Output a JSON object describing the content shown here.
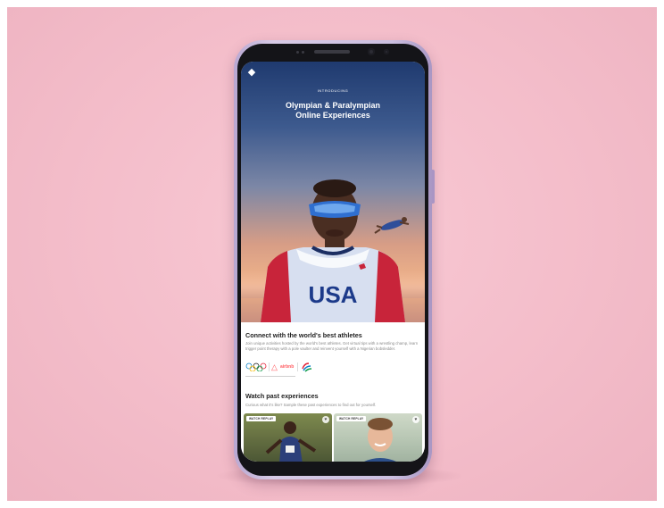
{
  "hero": {
    "eyebrow": "INTRODUCING",
    "title_line1": "Olympian & Paralympian",
    "title_line2": "Online Experiences",
    "jersey_text": "USA"
  },
  "connect": {
    "title": "Connect with the world's best athletes",
    "body": "Join unique activities hosted by the world's best athletes. Get virtual tips with a wrestling champ, learn trigger point therapy with a pole vaulter and reinvent yourself with a Nigerian bobsledder.",
    "partner_name": "airbnb"
  },
  "watch": {
    "title": "Watch past experiences",
    "subtitle": "Curious what it's like? Sample these past experiences to find out for yourself.",
    "cards": [
      {
        "badge": "WATCH REPLAY"
      },
      {
        "badge": "WATCH REPLAY"
      }
    ]
  },
  "icons": {
    "logo": "airbnb-logo-icon",
    "heart": "heart-icon",
    "olympic_rings": "olympic-rings-icon",
    "paralympic": "paralympic-agitos-icon"
  },
  "colors": {
    "background": "#f3bcc9",
    "phone_frame": "#cbbfe0",
    "airbnb": "#ff5a5f"
  }
}
